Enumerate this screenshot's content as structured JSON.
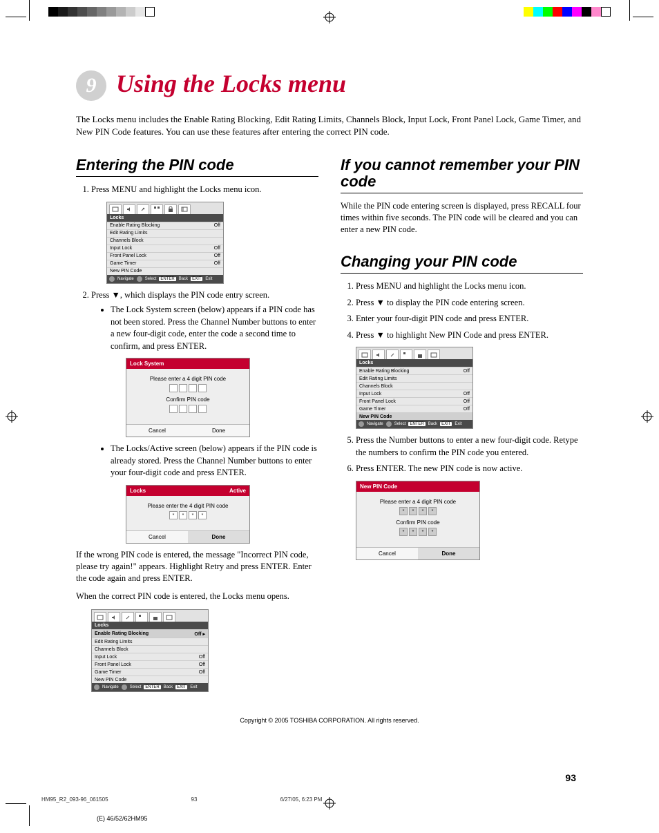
{
  "chapter": {
    "number": "9",
    "title": "Using the Locks menu"
  },
  "intro": "The Locks menu includes the Enable Rating Blocking, Edit Rating Limits, Channels Block, Input Lock, Front Panel Lock, Game Timer, and New PIN Code features. You can use these features after entering the correct PIN code.",
  "left": {
    "sec1_title": "Entering the PIN code",
    "step1": "Press MENU and highlight the Locks menu icon.",
    "step2a": "Press ▼, which displays the PIN code entry screen.",
    "bullet1": "The Lock System screen (below) appears if a PIN code has not been stored. Press the Channel Number buttons to enter a new four-digit code, enter the code a second time to confirm, and press ENTER.",
    "bullet2": "The Locks/Active screen (below) appears if the PIN code is already stored. Press the Channel Number buttons to enter your four-digit code and press ENTER.",
    "wrong": "If the wrong PIN code is entered, the message \"Incorrect PIN code, please try again!\" appears. Highlight Retry and press ENTER. Enter the code again and press ENTER.",
    "correct": "When the correct PIN code is entered, the Locks menu opens."
  },
  "right": {
    "sec2_title": "If you cannot remember your PIN code",
    "sec2_body": "While the PIN code entering screen is displayed, press RECALL four times within five seconds. The PIN code will be cleared and you can enter a new PIN code.",
    "sec3_title": "Changing your PIN code",
    "step1": "Press MENU and highlight the Locks menu icon.",
    "step2": "Press ▼ to display the PIN code entering screen.",
    "step3": "Enter your four-digit PIN code and press ENTER.",
    "step4": "Press ▼ to highlight New PIN Code and press ENTER.",
    "step5": "Press the Number buttons to enter a new four-digit code. Retype the numbers to confirm the PIN code you entered.",
    "step6": "Press ENTER. The new PIN code is now active."
  },
  "osd": {
    "locks_header": "Locks",
    "rows": {
      "enable": "Enable Rating Blocking",
      "edit": "Edit Rating Limits",
      "channels": "Channels Block",
      "input": "Input Lock",
      "front": "Front Panel Lock",
      "game": "Game Timer",
      "newpin": "New PIN Code"
    },
    "off": "Off",
    "nav": {
      "navigate": "Navigate",
      "select": "Select",
      "back": "Back",
      "exit": "Exit",
      "enter": "ENTER",
      "exitbtn": "EXIT"
    },
    "lock_system": {
      "title": "Lock System",
      "enter": "Please enter a 4 digit PIN code",
      "confirm": "Confirm PIN code",
      "cancel": "Cancel",
      "done": "Done"
    },
    "active": {
      "title": "Locks",
      "status": "Active",
      "enter": "Please enter the 4 digit PIN code",
      "cancel": "Cancel",
      "done": "Done"
    },
    "newpin_dlg": {
      "title": "New PIN Code",
      "enter": "Please enter a 4 digit PIN code",
      "confirm": "Confirm PIN code",
      "cancel": "Cancel",
      "done": "Done"
    }
  },
  "copyright": "Copyright © 2005 TOSHIBA CORPORATION. All rights reserved.",
  "pagenum": "93",
  "footer": {
    "file": "HM95_R2_093-96_061505",
    "pg": "93",
    "date": "6/27/05, 6:23 PM"
  },
  "model": "(E) 46/52/62HM95",
  "colorbars": {
    "gray": [
      "#000",
      "#1a1a1a",
      "#333",
      "#4d4d4d",
      "#666",
      "#808080",
      "#999",
      "#b3b3b3",
      "#ccc",
      "#e6e6e6",
      "#fff"
    ],
    "cmyk": [
      "#ff0",
      "#0ff",
      "#0f0",
      "#f00",
      "#00f",
      "#f0f",
      "#000",
      "#f8c",
      "#fff"
    ]
  }
}
